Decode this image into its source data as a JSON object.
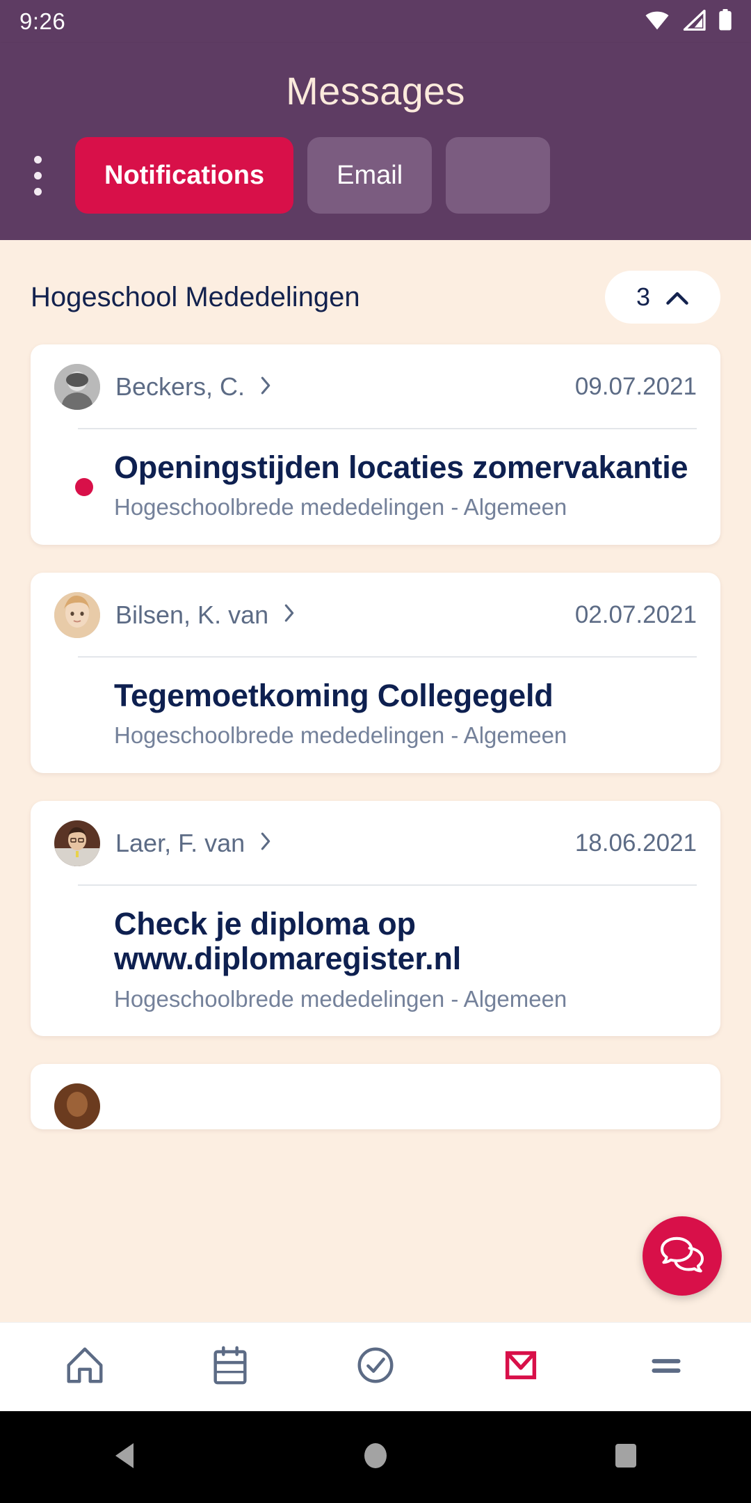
{
  "status_bar": {
    "time": "9:26",
    "icons": [
      "wifi-icon",
      "cellular-signal-icon",
      "battery-icon"
    ]
  },
  "header": {
    "title": "Messages",
    "overflow_label": "more-options",
    "background_color": "#5E3C63",
    "accent_color": "#D81049",
    "tabs": [
      {
        "label": "Notifications",
        "active": true
      },
      {
        "label": "Email",
        "active": false
      },
      {
        "label": "",
        "active": false
      }
    ]
  },
  "section": {
    "title": "Hogeschool Mededelingen",
    "count": "3",
    "collapse_icon": "chevron-up-icon"
  },
  "messages": [
    {
      "sender": "Beckers, C.",
      "date": "09.07.2021",
      "title": "Openingstijden locaties zomervakantie",
      "subtitle": "Hogeschoolbrede mededelingen - Algemeen",
      "unread": true
    },
    {
      "sender": "Bilsen, K. van",
      "date": "02.07.2021",
      "title": "Tegemoetkoming Collegegeld",
      "subtitle": "Hogeschoolbrede mededelingen - Algemeen",
      "unread": false
    },
    {
      "sender": "Laer, F. van",
      "date": "18.06.2021",
      "title": "Check je diploma op www.diplomaregister.nl",
      "subtitle": "Hogeschoolbrede mededelingen - Algemeen",
      "unread": false
    }
  ],
  "fab": {
    "icon": "chat-bubbles-icon",
    "color": "#D81049"
  },
  "bottom_nav": [
    {
      "icon": "home-icon",
      "active": false
    },
    {
      "icon": "calendar-icon",
      "active": false
    },
    {
      "icon": "check-circle-icon",
      "active": false
    },
    {
      "icon": "mail-icon",
      "active": true
    },
    {
      "icon": "hamburger-menu-icon",
      "active": false
    }
  ],
  "android_nav": [
    {
      "icon": "back-triangle-icon"
    },
    {
      "icon": "home-circle-icon"
    },
    {
      "icon": "recents-square-icon"
    }
  ],
  "colors": {
    "page_background": "#FCEEE1",
    "card_background": "#FFFFFF",
    "title_text": "#0E2050",
    "muted_text": "#5C6B85",
    "accent": "#D81049",
    "header": "#5E3C63"
  }
}
